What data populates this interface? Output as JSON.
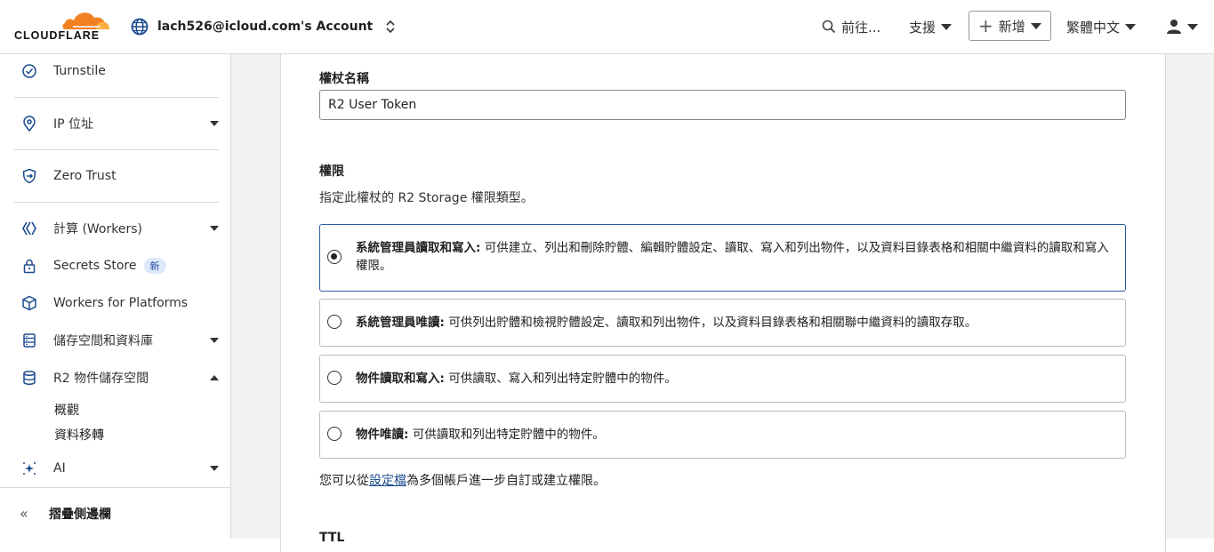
{
  "brand": {
    "name": "CLOUDFLARE",
    "orange": "#f38020",
    "light_orange": "#faae40"
  },
  "header": {
    "account": "lach526@icloud.com's Account",
    "goto": "前往...",
    "support": "支援",
    "add_new": "新增",
    "language": "繁體中文"
  },
  "sidebar": {
    "items": [
      {
        "label": "Turnstile",
        "icon": "turnstile-icon"
      },
      {
        "label": "IP 位址",
        "icon": "location-pin-icon"
      },
      {
        "label": "Zero Trust",
        "icon": "zero-trust-shield-icon"
      },
      {
        "label": "計算 (Workers)",
        "icon": "workers-icon"
      },
      {
        "label": "Secrets Store",
        "icon": "lock-icon",
        "badge": "新"
      },
      {
        "label": "Workers for Platforms",
        "icon": "cube-icon"
      },
      {
        "label": "儲存空間和資料庫",
        "icon": "database-icon"
      },
      {
        "label": "R2 物件儲存空間",
        "icon": "storage-bucket-icon"
      },
      {
        "label": "AI",
        "icon": "sparkle-icon"
      }
    ],
    "r2_sub": [
      "概觀",
      "資料移轉"
    ],
    "collapse": "摺疊側邊欄"
  },
  "form": {
    "token_name_label": "權杖名稱",
    "token_name_value": "R2 User Token",
    "permissions_label": "權限",
    "permissions_desc": "指定此權杖的 R2 Storage 權限類型。",
    "options": [
      {
        "title": "系統管理員讀取和寫入:",
        "desc": " 可供建立、列出和刪除貯體、編輯貯體設定、讀取、寫入和列出物件，以及資料目錄表格和相關中繼資料的讀取和寫入權限。",
        "selected": true
      },
      {
        "title": "系統管理員唯讀:",
        "desc": " 可供列出貯體和檢視貯體設定、讀取和列出物件，以及資料目錄表格和相關聯中繼資料的讀取存取。",
        "selected": false
      },
      {
        "title": "物件讀取和寫入:",
        "desc": " 可供讀取、寫入和列出特定貯體中的物件。",
        "selected": false
      },
      {
        "title": "物件唯讀:",
        "desc": " 可供讀取和列出特定貯體中的物件。",
        "selected": false
      }
    ],
    "footnote_before": "您可以從",
    "footnote_link": "設定檔",
    "footnote_after": "為多個帳戶進一步自訂或建立權限。",
    "ttl_label": "TTL"
  }
}
